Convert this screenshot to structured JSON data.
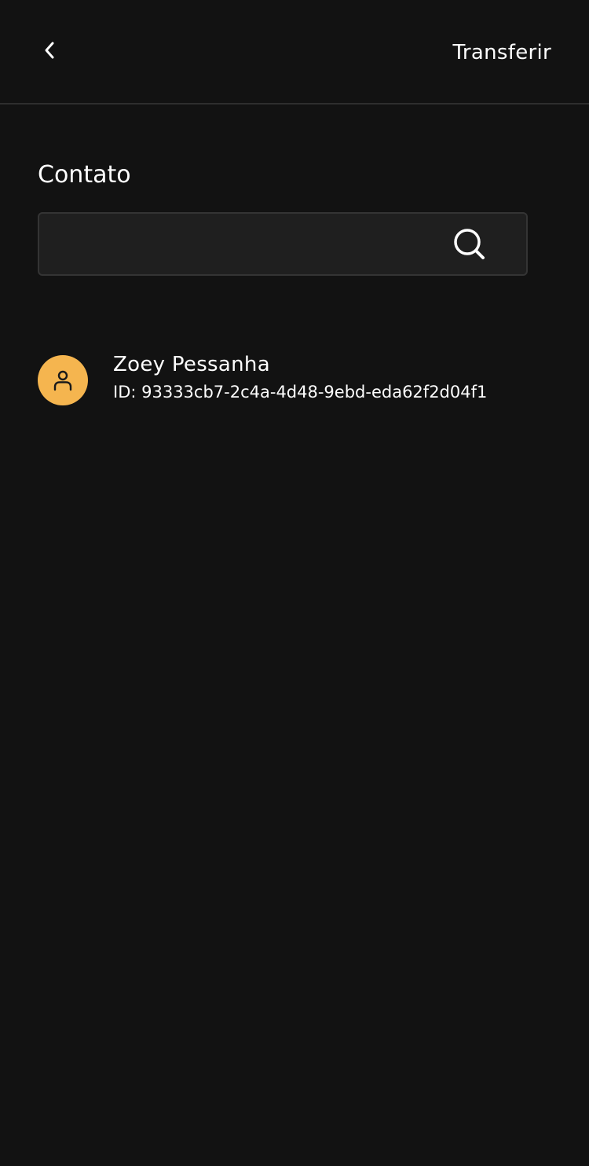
{
  "header": {
    "back_icon": "chevron-left-icon",
    "title": "Transferir"
  },
  "contact_section": {
    "label": "Contato",
    "search": {
      "value": "",
      "placeholder": "",
      "icon": "search-icon"
    }
  },
  "contacts": [
    {
      "name": "Zoey Pessanha",
      "id_text": "ID: 93333cb7-2c4a-4d48-9ebd-eda62f2d04f1",
      "avatar_icon": "user-icon",
      "avatar_color": "#f5b54f"
    }
  ],
  "colors": {
    "background": "#121212",
    "input_background": "#1f1f1f",
    "divider": "#2e2e2e",
    "text": "#ffffff",
    "accent": "#f5b54f"
  }
}
